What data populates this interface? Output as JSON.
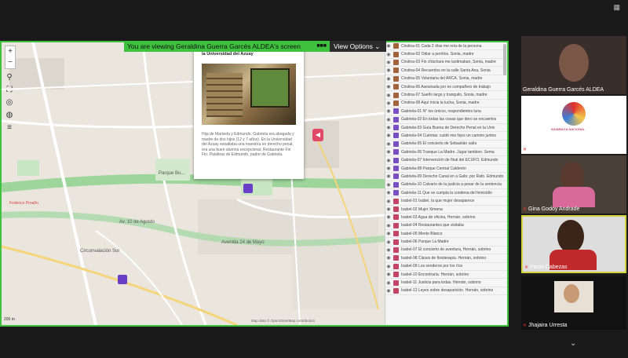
{
  "share_banner": {
    "text": "You are viewing Geraldina Guerra Garcés ALDEA's screen",
    "dots": "■■■"
  },
  "view_options": {
    "label": "View Options ⌄"
  },
  "popup": {
    "title": "Gabriela-01 Estudiante de Derecho Penal en la Universidad del Azuay",
    "body": "Hija de Marisela y Edmundo. Gabriela era abogada y madre de dos hijos (12 y 7 años). En la Universidad del Azuay estudiaba una maestría en derecho penal, era una buen alumna excepcional. Restaurante Fin Fin. Palabras de Edmundo, padre de Gabriela."
  },
  "map_labels": {
    "l1": "Parque Bo...",
    "l2": "Circunvalación Sur",
    "l3": "Av. 10 de Agosto",
    "l4": "Federico Proaño",
    "l5": "Avenida 24 de Mayo",
    "scale": "200 m",
    "attribution": "Map data © OpenStreetMap contributors"
  },
  "list_items": [
    {
      "label": "Cristina-01 Cada 2 días me reía de la persona",
      "color": "#a2623c"
    },
    {
      "label": "Cristina-02 Odiar a perritos. Sonia, madre",
      "color": "#a2623c"
    },
    {
      "label": "Cristina-03 Fin cháchara me lastimaban, Sonia, madre",
      "color": "#a2623c"
    },
    {
      "label": "Cristina-04 Recuerdos en la calle Santa Ana, Sonia",
      "color": "#a2623c"
    },
    {
      "label": "Cristina-05 Voluntaria del ARCA. Sonia, madre",
      "color": "#a2623c"
    },
    {
      "label": "Cristina-06 Asesinada por ex compañero de trabajo",
      "color": "#a2623c"
    },
    {
      "label": "Cristina-07 Sueño largo y tranquilo, Sonia, madre",
      "color": "#a2623c"
    },
    {
      "label": "Cristina-08 Aquí inicia la lucha, Sonia, madre",
      "color": "#a2623c"
    },
    {
      "label": "Gabriela-01 N° los únicos, respondientes luna",
      "color": "#7a4fc2"
    },
    {
      "label": "Gabriela-02 En todas las cosas que dero se encuentra",
      "color": "#7a4fc2"
    },
    {
      "label": "Gabriela-03 Guía Buena de Derecho Penal en la Univ",
      "color": "#7a4fc2"
    },
    {
      "label": "Gabriela-04 Cuéntas: cuidé mis hijos un camino juntos",
      "color": "#7a4fc2"
    },
    {
      "label": "Gabriela-05 El concierto de Sebastián salía",
      "color": "#7a4fc2"
    },
    {
      "label": "Gabriela-06 Tranque La Madre. Jugar tambien. Sema",
      "color": "#7a4fc2"
    },
    {
      "label": "Gabriela-07 Intervención de final del ECUFO, Edmundo",
      "color": "#7a4fc2"
    },
    {
      "label": "Gabriela-08 Parque Central Calderón",
      "color": "#7a4fc2"
    },
    {
      "label": "Gabriela-09 Derecho Canal en a Gabr. por Rafo. Edmundo",
      "color": "#7a4fc2"
    },
    {
      "label": "Gabriela-10 Calvario de la justicia a pesar de la sentencia",
      "color": "#7a4fc2"
    },
    {
      "label": "Gabriela-11 Que se cumpla la condena del femicidio",
      "color": "#7a4fc2"
    },
    {
      "label": "Isabel-01 Isabel, la que mujer desaparece",
      "color": "#c24466"
    },
    {
      "label": "Isabel-02 Mujer Ximena",
      "color": "#c24466"
    },
    {
      "label": "Isabel-03 Agua de oficina, Hernán, sobrino",
      "color": "#c24466"
    },
    {
      "label": "Isabel-04 Restaurantes que visitaba",
      "color": "#c24466"
    },
    {
      "label": "Isabel-05 Mente Blanco",
      "color": "#c24466"
    },
    {
      "label": "Isabel-06 Parque La Madre",
      "color": "#c24466"
    },
    {
      "label": "Isabel-07 El concierto de aventura, Hernán, sobrino",
      "color": "#c24466"
    },
    {
      "label": "Isabel-08 Clases de fisioterapia. Hernán, sobrino",
      "color": "#c24466"
    },
    {
      "label": "Isabel-09 Los senderos por los ríos",
      "color": "#c24466"
    },
    {
      "label": "Isabel-10 Encontraría. Hernán, sobrino",
      "color": "#c24466"
    },
    {
      "label": "Isabel-11 Justicia para todas. Hernán, sobrino",
      "color": "#c24466"
    },
    {
      "label": "Isabel-12 Leyes sobre desaparición. Hernán, sobrino",
      "color": "#c24466"
    }
  ],
  "participants": [
    {
      "name": "Geraldina Guerra Garcés ALDEA"
    },
    {
      "name": "FOTOGRAFIA OFICIAL ASAMBLEA N..."
    },
    {
      "name": "Gina Godoy Andrade"
    },
    {
      "name": "Pacto Cabezas"
    },
    {
      "name": "Jhajaira Urresta"
    }
  ],
  "org_logo_text": "ASAMBLEA NACIONAL"
}
